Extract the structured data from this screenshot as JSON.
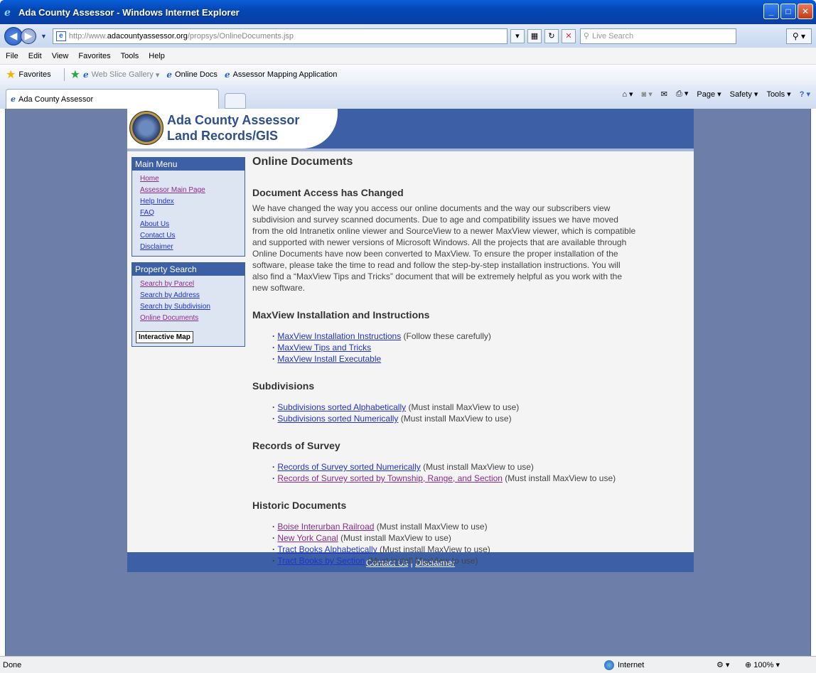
{
  "window": {
    "title": "Ada County Assessor - Windows Internet Explorer"
  },
  "address": {
    "url_prefix": "http://www.",
    "url_domain": "adacountyassessor.org",
    "url_path": "/propsys/OnlineDocuments.jsp",
    "search_placeholder": "Live Search"
  },
  "menu": [
    "File",
    "Edit",
    "View",
    "Favorites",
    "Tools",
    "Help"
  ],
  "favorites": {
    "label": "Favorites",
    "items": [
      "Web Slice Gallery",
      "Online Docs",
      "Assessor Mapping Application"
    ]
  },
  "tab": {
    "label": "Ada County Assessor"
  },
  "command_bar": [
    "Page",
    "Safety",
    "Tools"
  ],
  "site": {
    "name_line1": "Ada County Assessor",
    "name_line2": "Land Records/GIS",
    "main_menu": {
      "title": "Main Menu",
      "items": [
        "Home",
        "Assessor Main Page",
        "Help Index",
        "FAQ",
        "About Us",
        "Contact Us",
        "Disclaimer"
      ]
    },
    "property_search": {
      "title": "Property Search",
      "items": [
        "Search by Parcel",
        "Search by Address",
        "Search by Subdivision",
        "Online Documents"
      ],
      "map_button": "Interactive Map"
    },
    "content": {
      "title": "Online Documents",
      "access_heading": "Document Access has Changed",
      "access_text": "We have changed the way you access our online documents and the way our subscribers view subdivision and survey scanned documents. Due to age and compatibility issues we have moved from the old Intranetix online viewer and SourceView to a newer MaxView viewer, which is compatible and supported with newer versions of Microsoft Windows. All the projects that are available through Online Documents have now been converted to MaxView. To ensure the proper installation of the software, please take the time to read and follow the step-by-step installation instructions. You will also find a “MaxView Tips and Tricks” document that will be extremely helpful as you work with the new software.",
      "maxview_heading": "MaxView Installation and Instructions",
      "maxview_links": [
        {
          "link": "MaxView Installation Instructions",
          "note": " (Follow these carefully)"
        },
        {
          "link": "MaxView Tips and Tricks",
          "note": ""
        },
        {
          "link": "MaxView Install Executable",
          "note": ""
        }
      ],
      "subdivisions_heading": "Subdivisions",
      "subdivisions_links": [
        {
          "link": "Subdivisions sorted Alphabetically",
          "note": " (Must install MaxView to use)"
        },
        {
          "link": "Subdivisions sorted Numerically",
          "note": " (Must install MaxView to use)"
        }
      ],
      "records_heading": "Records of Survey",
      "records_links": [
        {
          "link": "Records of Survey sorted Numerically",
          "note": " (Must install MaxView to use)"
        },
        {
          "link": "Records of Survey sorted by Township, Range, and Section",
          "note": " (Must install MaxView to use)"
        }
      ],
      "historic_heading": "Historic Documents",
      "historic_links": [
        {
          "link": "Boise Interurban Railroad",
          "note": " (Must install MaxView to use)"
        },
        {
          "link": "New York Canal",
          "note": " (Must install MaxView to use)"
        },
        {
          "link": "Tract Books Alphabetically",
          "note": " (Must install MaxView to use)"
        },
        {
          "link": "Tract Books by Section",
          "note": " (Must install MaxView to use)"
        }
      ]
    },
    "footer": {
      "contact": "Contact Us",
      "divider": " | ",
      "disclaimer": "Disclaimer"
    }
  },
  "status": {
    "text": "Done",
    "zone": "Internet",
    "zoom": "100%"
  }
}
